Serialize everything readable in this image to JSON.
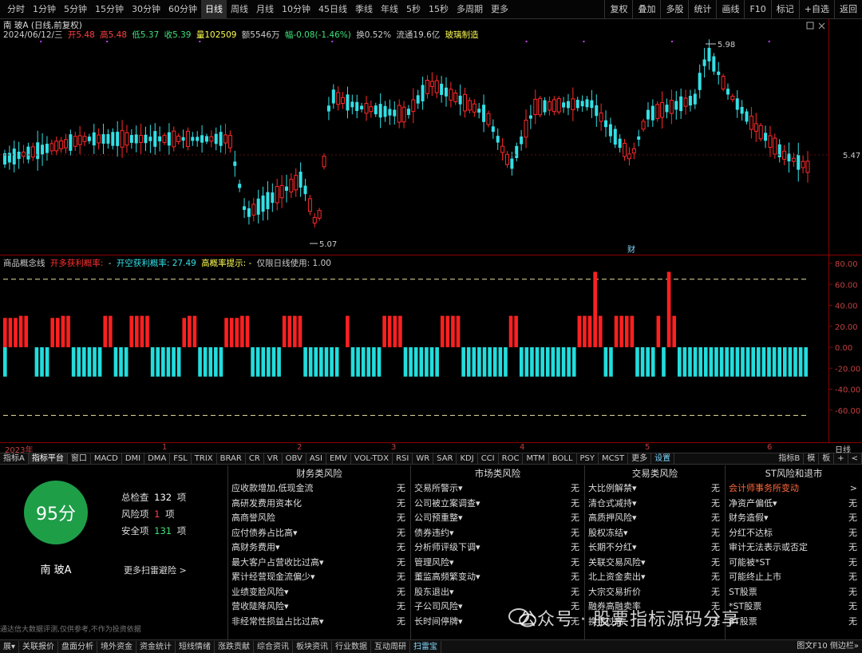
{
  "toolbar": {
    "periods": [
      "分时",
      "1分钟",
      "5分钟",
      "15分钟",
      "30分钟",
      "60分钟",
      "日线",
      "周线",
      "月线",
      "10分钟",
      "45日线",
      "季线",
      "年线",
      "5秒",
      "15秒",
      "多周期",
      "更多"
    ],
    "active_period": "日线",
    "tools": [
      "复权",
      "叠加",
      "多股",
      "统计",
      "画线",
      "F10",
      "标记",
      "+自选",
      "返回"
    ]
  },
  "price_chart": {
    "legend": {
      "name": "南 玻A (日线,前复权)",
      "date": "2024/06/12/三",
      "open": "开5.48",
      "high": "高5.48",
      "low": "低5.37",
      "close": "收5.39",
      "volume": "量102509",
      "amount": "额5546万",
      "change": "幅-0.08(-1.46%)",
      "turnover": "换0.52%",
      "float": "流通19.6亿",
      "sector": "玻璃制造"
    },
    "price_label": "5.47",
    "high_marker": "5.98",
    "low_marker": "5.07",
    "event_marker": "财"
  },
  "indicator_chart": {
    "legend": {
      "name": "商品概念线",
      "long_label": "开多获利概率:",
      "short_label": "开空获利概率: 27.49",
      "high_prob": "高概率提示: -",
      "note": "仅限日线使用: 1.00"
    },
    "y_ticks": [
      "80.00",
      "60.00",
      "40.00",
      "20.00",
      "0.00",
      "-20.00",
      "-40.00",
      "-60.00"
    ]
  },
  "chart_data": {
    "type": "bar",
    "title": "商品概念线",
    "ylim": [
      -80,
      80
    ],
    "reference_lines": [
      65,
      -65
    ],
    "series": [
      {
        "name": "开多获利概率",
        "color": "#ff2020",
        "values": [
          28,
          28,
          28,
          30,
          30,
          0,
          0,
          0,
          0,
          28,
          28,
          30,
          30,
          0,
          0,
          0,
          0,
          0,
          0,
          30,
          30,
          0,
          0,
          0,
          30,
          30,
          30,
          30,
          0,
          0,
          0,
          0,
          0,
          0,
          28,
          30,
          30,
          0,
          0,
          0,
          0,
          0,
          28,
          28,
          28,
          30,
          30,
          0,
          0,
          0,
          0,
          0,
          0,
          30,
          30,
          30,
          30,
          0,
          0,
          0,
          0,
          0,
          0,
          0,
          0,
          30,
          0,
          0,
          0,
          0,
          0,
          0,
          30,
          30,
          30,
          30,
          0,
          0,
          0,
          0,
          0,
          0,
          0,
          30,
          30,
          30,
          30,
          0,
          0,
          0,
          0,
          0,
          0,
          0,
          0,
          0,
          30,
          30,
          0,
          0,
          0,
          0,
          0,
          0,
          0,
          0,
          0,
          0,
          0,
          30,
          30,
          30,
          72,
          30,
          0,
          0,
          30,
          30,
          30,
          30,
          0,
          0,
          0,
          0,
          30,
          0,
          72,
          30,
          0,
          0,
          0,
          0,
          0,
          0,
          0,
          0,
          0,
          0,
          0,
          0,
          0,
          0,
          0,
          0,
          0,
          0,
          0,
          0,
          0,
          0,
          0,
          0,
          0
        ]
      },
      {
        "name": "开空获利概率",
        "color": "#22dddd",
        "values": [
          -28,
          0,
          0,
          0,
          0,
          0,
          -28,
          -28,
          -28,
          0,
          0,
          0,
          0,
          -28,
          -28,
          -28,
          -28,
          -28,
          -28,
          0,
          0,
          -28,
          -28,
          -28,
          0,
          0,
          0,
          0,
          -28,
          -28,
          -28,
          -28,
          -28,
          -28,
          0,
          0,
          0,
          -28,
          -28,
          -28,
          -28,
          -28,
          0,
          0,
          0,
          0,
          0,
          -28,
          -28,
          -28,
          -28,
          -28,
          -28,
          0,
          0,
          0,
          0,
          -28,
          -28,
          -28,
          -28,
          -28,
          -28,
          -28,
          0,
          0,
          -28,
          -28,
          -28,
          -28,
          -28,
          -28,
          0,
          0,
          0,
          0,
          -28,
          -28,
          -28,
          -28,
          -28,
          -28,
          -28,
          0,
          0,
          0,
          0,
          -28,
          -28,
          -28,
          -28,
          -28,
          -28,
          -28,
          -28,
          -28,
          0,
          0,
          -28,
          -28,
          -28,
          -28,
          -28,
          -28,
          -28,
          -28,
          -28,
          -28,
          -28,
          0,
          0,
          0,
          0,
          0,
          -28,
          -28,
          0,
          0,
          0,
          0,
          -28,
          -28,
          -28,
          -28,
          0,
          -28,
          0,
          0,
          -28,
          -28,
          -28,
          -28,
          -28,
          -28,
          -28,
          -28,
          -28,
          -28,
          -28,
          -28,
          -28,
          -28,
          -28,
          -28,
          -28,
          -28,
          -28,
          -28,
          -28,
          -28,
          -28,
          -28,
          -28
        ]
      }
    ]
  },
  "timeaxis": {
    "labels": [
      "2023年",
      "1",
      "2",
      "3",
      "4",
      "5",
      "6"
    ],
    "right": "日线"
  },
  "indicator_tabs": [
    "指标A",
    "指标平台",
    "窗口",
    "MACD",
    "DMI",
    "DMA",
    "FSL",
    "TRIX",
    "BRAR",
    "CR",
    "VR",
    "OBV",
    "ASI",
    "EMV",
    "VOL-TDX",
    "RSI",
    "WR",
    "SAR",
    "KDJ",
    "CCI",
    "ROC",
    "MTM",
    "BOLL",
    "PSY",
    "MCST",
    "更多",
    "设置"
  ],
  "indicator_tabs_right": [
    "指标B",
    "模",
    "板",
    "+",
    "<"
  ],
  "risk": {
    "score": "95分",
    "stock_name": "南 玻A",
    "total_label": "总检查",
    "total_num": "132",
    "total_unit": "项",
    "risk_label": "风险项",
    "risk_num": "1",
    "risk_unit": "项",
    "safe_label": "安全项",
    "safe_num": "131",
    "safe_unit": "项",
    "more_link": "更多扫雷避险 >",
    "columns": [
      {
        "title": "财务类风险",
        "rows": [
          {
            "label": "应收款增加,低现金流",
            "val": "无"
          },
          {
            "label": "高研发费用资本化",
            "val": "无"
          },
          {
            "label": "高商誉风险",
            "val": "无"
          },
          {
            "label": "应付债券占比高▾",
            "val": "无"
          },
          {
            "label": "高财务费用▾",
            "val": "无"
          },
          {
            "label": "最大客户占营收比过高▾",
            "val": "无"
          },
          {
            "label": "累计经营现金流偏少▾",
            "val": "无"
          },
          {
            "label": "业绩变脸风险▾",
            "val": "无"
          },
          {
            "label": "营收陡降风险▾",
            "val": "无"
          },
          {
            "label": "非经常性损益占比过高▾",
            "val": "无"
          }
        ]
      },
      {
        "title": "市场类风险",
        "rows": [
          {
            "label": "交易所警示▾",
            "val": "无"
          },
          {
            "label": "公司被立案调查▾",
            "val": "无"
          },
          {
            "label": "公司预重整▾",
            "val": "无"
          },
          {
            "label": "债券违约▾",
            "val": "无"
          },
          {
            "label": "分析师评级下调▾",
            "val": "无"
          },
          {
            "label": "管理风险▾",
            "val": "无"
          },
          {
            "label": "董监高频繁变动▾",
            "val": "无"
          },
          {
            "label": "股东退出▾",
            "val": "无"
          },
          {
            "label": "子公司风险▾",
            "val": "无"
          },
          {
            "label": "长时间停牌▾",
            "val": "无"
          }
        ]
      },
      {
        "title": "交易类风险",
        "rows": [
          {
            "label": "大比例解禁▾",
            "val": "无"
          },
          {
            "label": "清仓式减持▾",
            "val": "无"
          },
          {
            "label": "高质押风险▾",
            "val": "无"
          },
          {
            "label": "股权冻结▾",
            "val": "无"
          },
          {
            "label": "长期不分红▾",
            "val": "无"
          },
          {
            "label": "关联交易风险▾",
            "val": "无"
          },
          {
            "label": "北上资金卖出▾",
            "val": "无"
          },
          {
            "label": "大宗交易折价",
            "val": "无"
          },
          {
            "label": "融券高融卖率",
            "val": "无"
          },
          {
            "label": "换手过高",
            "val": "无"
          }
        ]
      },
      {
        "title": "ST风险和退市",
        "rows": [
          {
            "label": "会计师事务所变动",
            "val": ">",
            "warn": true
          },
          {
            "label": "净资产偏低▾",
            "val": "无"
          },
          {
            "label": "财务造假▾",
            "val": "无"
          },
          {
            "label": "分红不达标",
            "val": "无"
          },
          {
            "label": "审计无法表示或否定",
            "val": "无"
          },
          {
            "label": "可能被*ST",
            "val": "无"
          },
          {
            "label": "可能终止上市",
            "val": "无"
          },
          {
            "label": "ST股票",
            "val": "无"
          },
          {
            "label": "*ST股票",
            "val": "无"
          },
          {
            "label": "ST股票",
            "val": "无"
          }
        ]
      }
    ],
    "disclaimer": "通达信大数据评测,仅供参考,不作为投资依据"
  },
  "bottom_tabs": [
    "展▾",
    "关联报价",
    "盘面分析",
    "境外资金",
    "资金统计",
    "短线情绪",
    "涨跌贡献",
    "综合资讯",
    "板块资讯",
    "行业数据",
    "互动周研",
    "扫雷宝"
  ],
  "bottom_active": "扫雷宝",
  "bottom_right": "图文F10 侧边栏»",
  "watermark": "公众号 · 股票指标源码分享",
  "colors": {
    "up": "#ff2a2a",
    "down": "#33e0e6",
    "bg": "#000000",
    "grid": "#8b0000",
    "accent": "#7fd7ff",
    "score": "#1f9e48"
  }
}
